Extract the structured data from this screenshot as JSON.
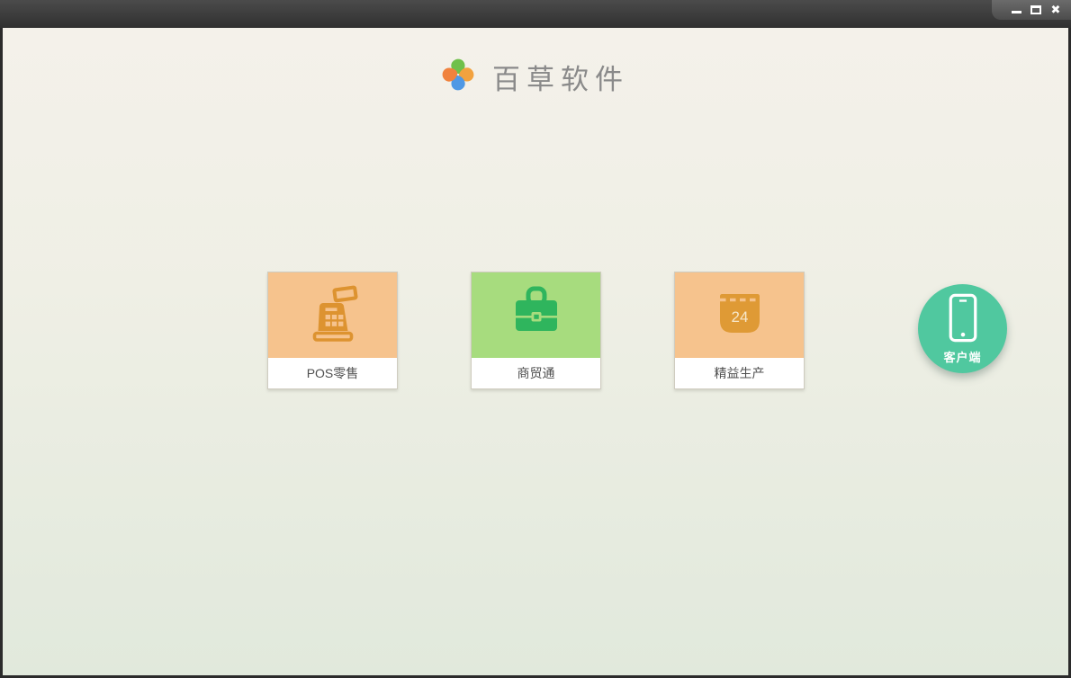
{
  "titlebar": {
    "controls": [
      {
        "icon": "minimize-icon"
      },
      {
        "icon": "maximize-icon"
      },
      {
        "icon": "close-icon"
      }
    ]
  },
  "header": {
    "app_name": "百草软件",
    "logo_icon": "pinwheel-icon",
    "logo_colors": {
      "top": "#6fc04a",
      "right": "#f2a23f",
      "bottom": "#5098e4",
      "left": "#f0823d"
    }
  },
  "products": [
    {
      "label": "POS零售",
      "icon": "cash-register-icon",
      "bg_color": "#f6c38d",
      "icon_color": "#dd9330"
    },
    {
      "label": "商贸通",
      "icon": "briefcase-icon",
      "bg_color": "#a7dc7e",
      "icon_color": "#2fb55d"
    },
    {
      "label": "精益生产",
      "icon": "calendar-icon",
      "bg_color": "#f6c38d",
      "icon_color": "#df9a35",
      "calendar_day": "24"
    }
  ],
  "client_button": {
    "label": "客户端",
    "icon": "smartphone-icon",
    "bg_color": "#50c89f"
  },
  "colors": {
    "titlebar": "#3a3a3a",
    "window_border": "#2b2b2b",
    "content_top": "#f4f1ea",
    "content_bottom": "#e1e9dc",
    "card_label_text": "#4f4f4f"
  }
}
